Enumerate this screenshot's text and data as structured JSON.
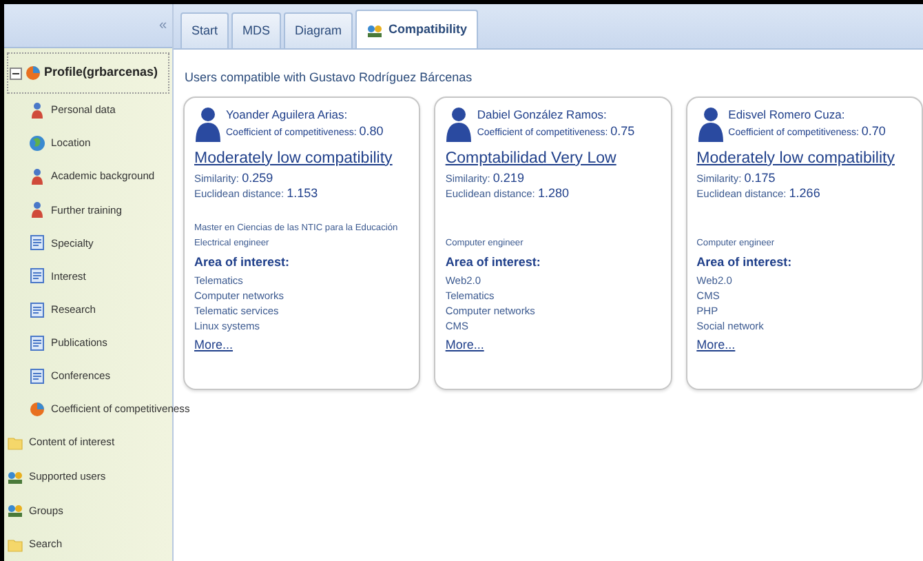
{
  "sidebar": {
    "collapse_button": "«",
    "profile": {
      "label": "Profile(grbarcenas)",
      "expanded": true,
      "children": [
        {
          "label": "Personal data",
          "kind": "person"
        },
        {
          "label": "Location",
          "kind": "globe"
        },
        {
          "label": "Academic background",
          "kind": "person"
        },
        {
          "label": "Further training",
          "kind": "person"
        },
        {
          "label": "Specialty",
          "kind": "document"
        },
        {
          "label": "Interest",
          "kind": "document"
        },
        {
          "label": "Research",
          "kind": "document"
        },
        {
          "label": "Publications",
          "kind": "document"
        },
        {
          "label": "Conferences",
          "kind": "document"
        },
        {
          "label": "Coefficient of competitiveness",
          "kind": "chart"
        }
      ]
    },
    "items": [
      {
        "label": "Content of interest",
        "kind": "folder"
      },
      {
        "label": "Supported users",
        "kind": "users"
      },
      {
        "label": "Groups",
        "kind": "users"
      },
      {
        "label": "Search",
        "kind": "folder"
      }
    ]
  },
  "tabs": [
    {
      "label": "Start",
      "selected": false,
      "kind": "plain"
    },
    {
      "label": "MDS",
      "selected": false,
      "kind": "plain"
    },
    {
      "label": "Diagram",
      "selected": false,
      "kind": "plain"
    },
    {
      "label": "Compatibility",
      "selected": true,
      "kind": "icon"
    }
  ],
  "content": {
    "heading": "Users compatible with Gustavo Rodríguez Bárcenas",
    "cards": [
      {
        "name": "Yoander Aguilera Arias:",
        "coefficient_label": "Coefficient of competitiveness:",
        "coefficient": "0.80",
        "compatibility": "Moderately low compatibility",
        "similarity_label": "Similarity:",
        "similarity": "0.259",
        "distance_label": "Euclidean distance:",
        "distance": "1.153",
        "professions": [
          "Master en Ciencias de las NTIC para la Educación",
          "Electrical engineer"
        ],
        "interest_label": "Area of interest:",
        "interests": [
          "Telematics",
          "Computer networks",
          "Telematic services",
          "Linux systems"
        ],
        "more": "More..."
      },
      {
        "name": "Dabiel  González Ramos:",
        "coefficient_label": "Coefficient of competitiveness:",
        "coefficient": "0.75",
        "compatibility": "Comptabilidad Very Low",
        "similarity_label": "Similarity:",
        "similarity": "0.219",
        "distance_label": "Euclidean distance:",
        "distance": "1.280",
        "professions": [
          "Computer engineer"
        ],
        "interest_label": "Area of interest:",
        "interests": [
          "Web2.0",
          "Telematics",
          "Computer networks",
          "CMS"
        ],
        "more": "More..."
      },
      {
        "name": "Edisvel Romero Cuza:",
        "coefficient_label": "Coefficient of competitiveness:",
        "coefficient": "0.70",
        "compatibility": "Moderately low compatibility",
        "similarity_label": "Similarity:",
        "similarity": "0.175",
        "distance_label": "Euclidean distance:",
        "distance": "1.266",
        "professions": [
          "Computer engineer"
        ],
        "interest_label": "Area of interest:",
        "interests": [
          "Web2.0",
          "CMS",
          "PHP",
          "Social network"
        ],
        "more": "More..."
      }
    ]
  }
}
